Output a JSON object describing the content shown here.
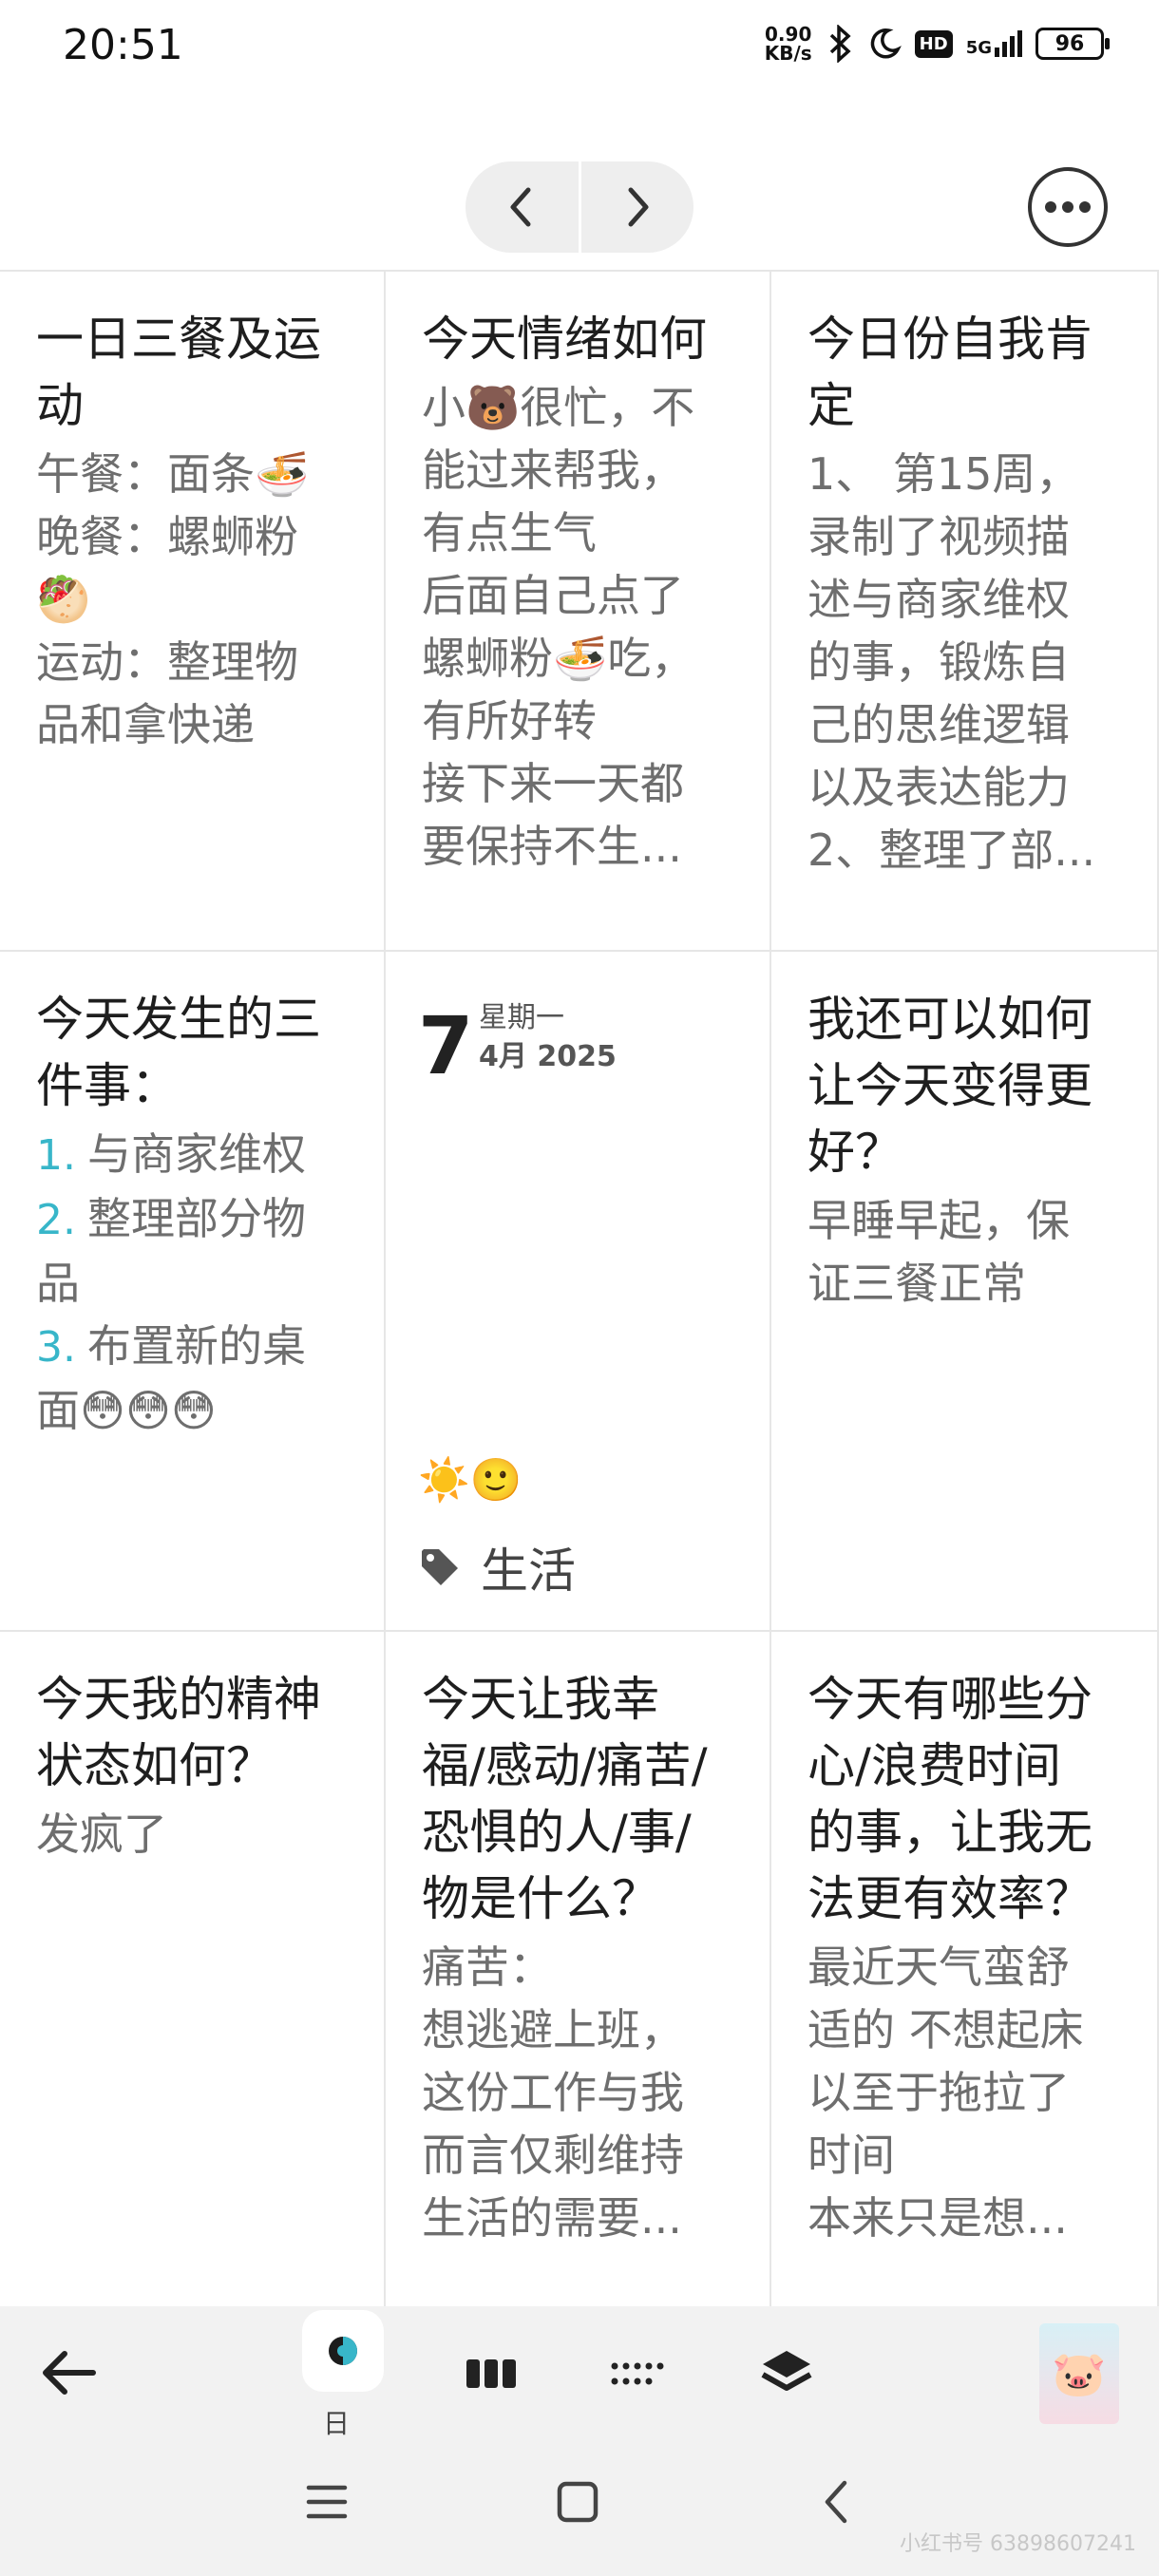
{
  "status_bar": {
    "time": "20:51",
    "net_speed_value": "0.90",
    "net_speed_unit": "KB/s",
    "hd": "HD",
    "network": "5G",
    "battery": "96"
  },
  "cards": {
    "meals": {
      "title_lines": [
        "一日三餐及运",
        "动"
      ],
      "body_lines": [
        "午餐：面条🍜",
        "晚餐：螺蛳粉",
        "🥙",
        "运动：整理物",
        "品和拿快递"
      ]
    },
    "mood": {
      "title_lines": [
        "今天情绪如何"
      ],
      "body_lines": [
        "小🐻很忙，不",
        "能过来帮我，",
        "有点生气",
        "后面自己点了",
        "螺蛳粉🍜吃，",
        "有所好转",
        "接下来一天都",
        "要保持不生..."
      ]
    },
    "affirmation": {
      "title_lines": [
        "今日份自我肯",
        "定"
      ],
      "body_lines": [
        "1、 第15周，",
        "录制了视频描",
        "述与商家维权",
        "的事，锻炼自",
        "己的思维逻辑",
        "以及表达能力",
        "2、整理了部..."
      ]
    },
    "three_things": {
      "title_lines": [
        "今天发生的三",
        "件事："
      ],
      "items": [
        {
          "num": "1.",
          "lines": [
            "与商家维权"
          ]
        },
        {
          "num": "2.",
          "lines": [
            "整理部分物",
            "品"
          ]
        },
        {
          "num": "3.",
          "lines": [
            "布置新的桌",
            "面😳😳😳"
          ]
        }
      ]
    },
    "date": {
      "day": "7",
      "weekday": "星期一",
      "month_year": "4月 2025",
      "weather": "☀️🙂",
      "tag": "生活"
    },
    "better": {
      "title_lines": [
        "我还可以如何",
        "让今天变得更",
        "好？"
      ],
      "body_lines": [
        "早睡早起，保",
        "证三餐正常"
      ]
    },
    "mental": {
      "title_lines": [
        "今天我的精神",
        "状态如何？"
      ],
      "body_lines": [
        "发疯了"
      ]
    },
    "feelings": {
      "title_lines": [
        "今天让我幸",
        "福/感动/痛苦/",
        "恐惧的人/事/",
        "物是什么？"
      ],
      "body_lines": [
        "痛苦：",
        "想逃避上班，",
        "这份工作与我",
        "而言仅剩维持",
        "生活的需要..."
      ]
    },
    "distractions": {
      "title_lines": [
        "今天有哪些分",
        "心/浪费时间",
        "的事，让我无",
        "法更有效率？"
      ],
      "body_lines": [
        "最近天气蛮舒",
        "适的 不想起床",
        "以至于拖拉了",
        "时间",
        "本来只是想..."
      ]
    }
  },
  "toolbar": {
    "day_label": "日"
  },
  "watermark": "小红书号 63898607241"
}
